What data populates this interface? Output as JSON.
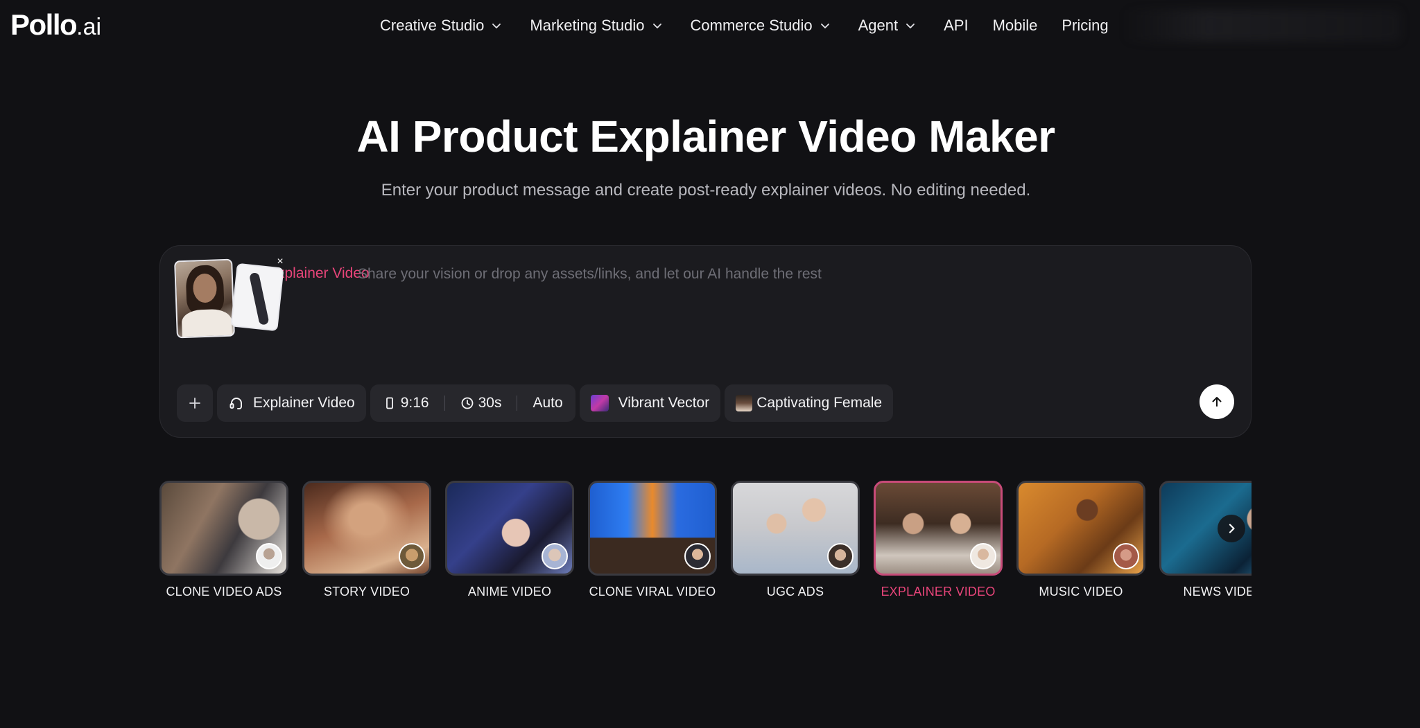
{
  "nav": {
    "logo_main": "Pollo",
    "logo_suffix": ".ai",
    "items": [
      {
        "label": "Creative Studio",
        "dropdown": true
      },
      {
        "label": "Marketing Studio",
        "dropdown": true
      },
      {
        "label": "Commerce Studio",
        "dropdown": true
      },
      {
        "label": "Agent",
        "dropdown": true
      },
      {
        "label": "API",
        "dropdown": false
      },
      {
        "label": "Mobile",
        "dropdown": false
      },
      {
        "label": "Pricing",
        "dropdown": false
      }
    ]
  },
  "hero": {
    "title": "AI Product Explainer Video Maker",
    "subtitle": "Enter your product message and create post-ready explainer videos. No editing needed."
  },
  "prompt": {
    "tag": "Explainer Video",
    "placeholder": "Share your vision or drop any assets/links, and let our AI handle the rest",
    "value": "",
    "close_glyph": "×",
    "toolbar": {
      "mode": "Explainer Video",
      "aspect": "9:16",
      "duration": "30s",
      "auto": "Auto",
      "style": "Vibrant Vector",
      "voice": "Captivating Female"
    }
  },
  "templates": [
    {
      "label": "CLONE VIDEO ADS",
      "active": false
    },
    {
      "label": "STORY VIDEO",
      "active": false
    },
    {
      "label": "ANIME VIDEO",
      "active": false
    },
    {
      "label": "CLONE VIRAL VIDEO",
      "active": false
    },
    {
      "label": "UGC ADS",
      "active": false
    },
    {
      "label": "EXPLAINER VIDEO",
      "active": true
    },
    {
      "label": "MUSIC VIDEO",
      "active": false
    },
    {
      "label": "NEWS VIDEO",
      "active": false
    }
  ],
  "colors": {
    "background": "#111114",
    "accent": "#e8457a",
    "card": "#1b1b1f",
    "chip": "#27272c"
  }
}
